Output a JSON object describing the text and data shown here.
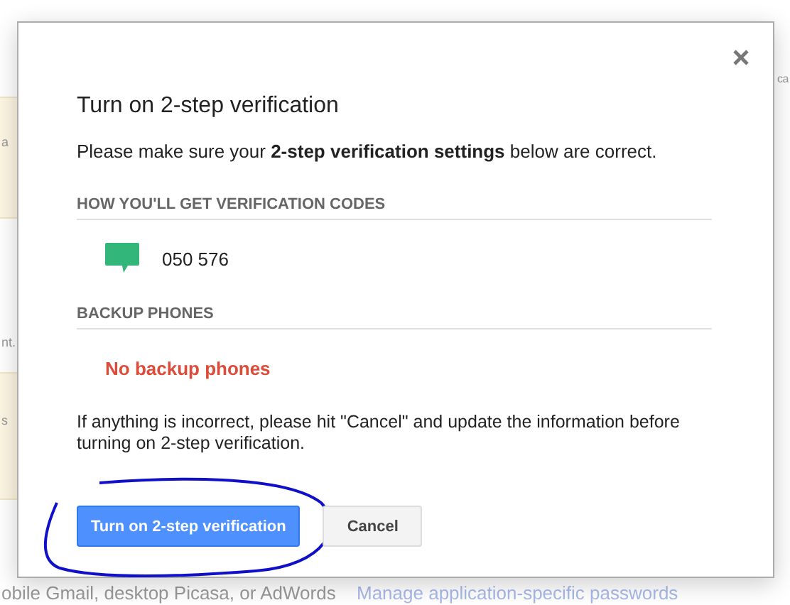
{
  "background_page": {
    "left_fragments": [
      "a",
      "nt.",
      "s"
    ],
    "right_fragments": [
      "ca"
    ],
    "footer_text": "obile Gmail, desktop Picasa, or AdWords",
    "footer_link": "Manage application-specific passwords"
  },
  "dialog": {
    "title": "Turn on 2-step verification",
    "intro": "Please make sure your **2-step verification settings** below are correct.",
    "sections": [
      {
        "heading": "HOW YOU'LL GET VERIFICATION CODES",
        "items": [
          {
            "kind": "sms",
            "text": "050 576"
          }
        ]
      },
      {
        "heading": "BACKUP PHONES",
        "items": [
          {
            "kind": "empty",
            "text": "No backup phones"
          }
        ]
      }
    ],
    "note": "If anything is incorrect, please hit \"Cancel\" and update the information before turning on 2-step verification.",
    "buttons": [
      {
        "label": "Turn on 2-step verification",
        "kind": "primary",
        "highlighted": true
      },
      {
        "label": "Cancel",
        "kind": "secondary",
        "highlighted": false
      }
    ]
  }
}
